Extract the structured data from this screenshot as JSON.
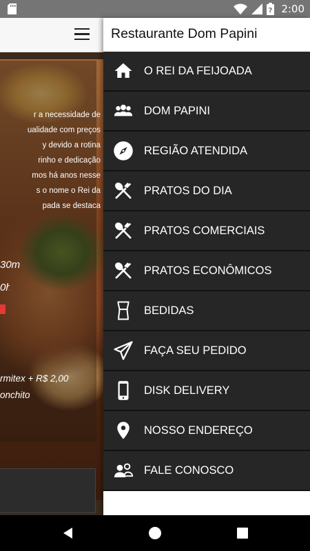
{
  "status_bar": {
    "time": "2:00",
    "battery_glyph": "?",
    "icons": [
      "sd-card-icon",
      "wifi-icon",
      "signal-icon",
      "battery-icon"
    ]
  },
  "background": {
    "lines": [
      "r a necessidade de",
      "ualidade com preços",
      "y devido a rotina",
      "rinho e dedicação",
      "mos há anos nesse",
      "s o nome o Rei da",
      "pada se destaca"
    ],
    "hours_1": "30m",
    "hours_2": "0h",
    "price_line": "rmitex + R$ 2,00",
    "item_line": "onchito"
  },
  "drawer": {
    "title": "Restaurante Dom Papini",
    "items": [
      {
        "label": "O REI DA FEIJOADA",
        "icon": "home-icon"
      },
      {
        "label": "DOM PAPINI",
        "icon": "group-icon"
      },
      {
        "label": "REGIÃO ATENDIDA",
        "icon": "compass-icon"
      },
      {
        "label": "PRATOS DO DIA",
        "icon": "cutlery-icon"
      },
      {
        "label": "PRATOS COMERCIAIS",
        "icon": "cutlery-icon"
      },
      {
        "label": "PRATOS ECONÔMICOS",
        "icon": "cutlery-icon"
      },
      {
        "label": "BEDIDAS",
        "icon": "glass-icon"
      },
      {
        "label": "FAÇA SEU PEDIDO",
        "icon": "send-icon"
      },
      {
        "label": "DISK DELIVERY",
        "icon": "phone-icon"
      },
      {
        "label": "NOSSO ENDEREÇO",
        "icon": "location-icon"
      },
      {
        "label": "FALE CONOSCO",
        "icon": "chat-people-icon"
      }
    ]
  },
  "colors": {
    "drawer_item_bg": "#262626",
    "status_bar": "#757575",
    "nav_bar": "#000000"
  }
}
